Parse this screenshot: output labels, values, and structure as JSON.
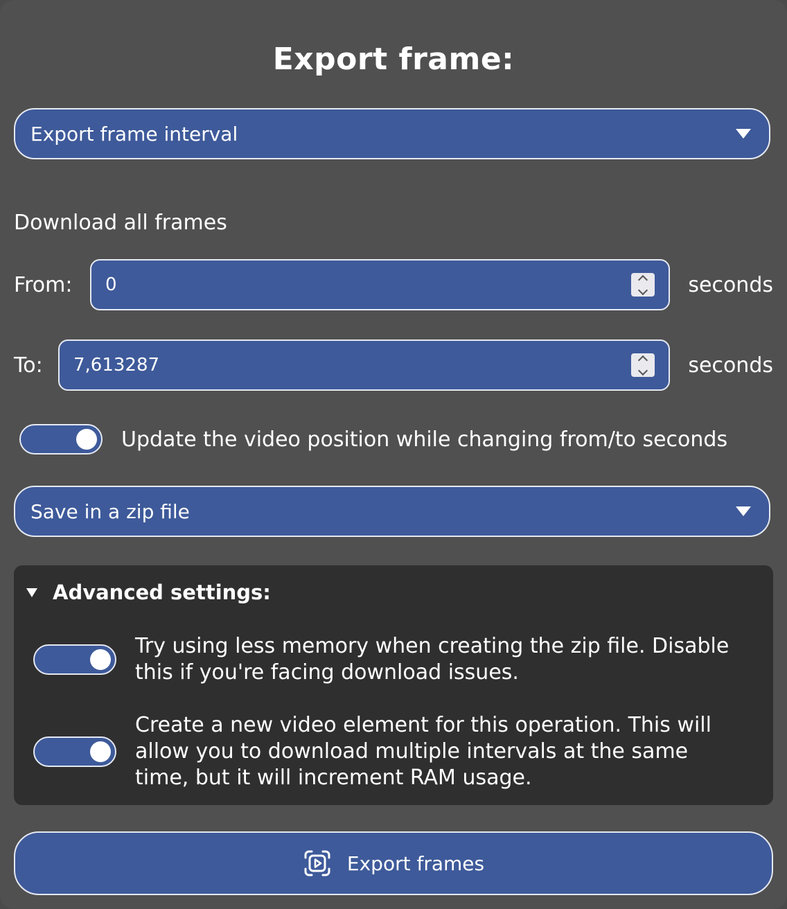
{
  "dialog": {
    "title": "Export frame:"
  },
  "mode_select": {
    "value": "Export frame interval"
  },
  "interval": {
    "heading": "Download all frames",
    "from_label": "From:",
    "from_value": "0",
    "to_label": "To:",
    "to_value": "7,613287",
    "unit": "seconds"
  },
  "sync_toggle": {
    "on": true,
    "label": "Update the video position while changing from/to seconds"
  },
  "save_select": {
    "value": "Save in a zip file"
  },
  "advanced": {
    "summary": "Advanced settings:",
    "low_memory_toggle": {
      "on": true,
      "line1": "Try using less memory when creating the zip file. Disable",
      "line2": "this if you're facing download issues."
    },
    "new_video_toggle": {
      "on": true,
      "line1": "Create a new video element for this operation. This will",
      "line2": "allow you to download multiple intervals at the same",
      "line3": "time, but it will increment RAM usage."
    }
  },
  "export_button": {
    "label": "Export frames",
    "icon": "play-frame-icon"
  },
  "colors": {
    "panel": "#505050",
    "accent": "#3e5a9a",
    "advanced_bg": "#2f2f2f",
    "border": "#e6e9f2"
  }
}
